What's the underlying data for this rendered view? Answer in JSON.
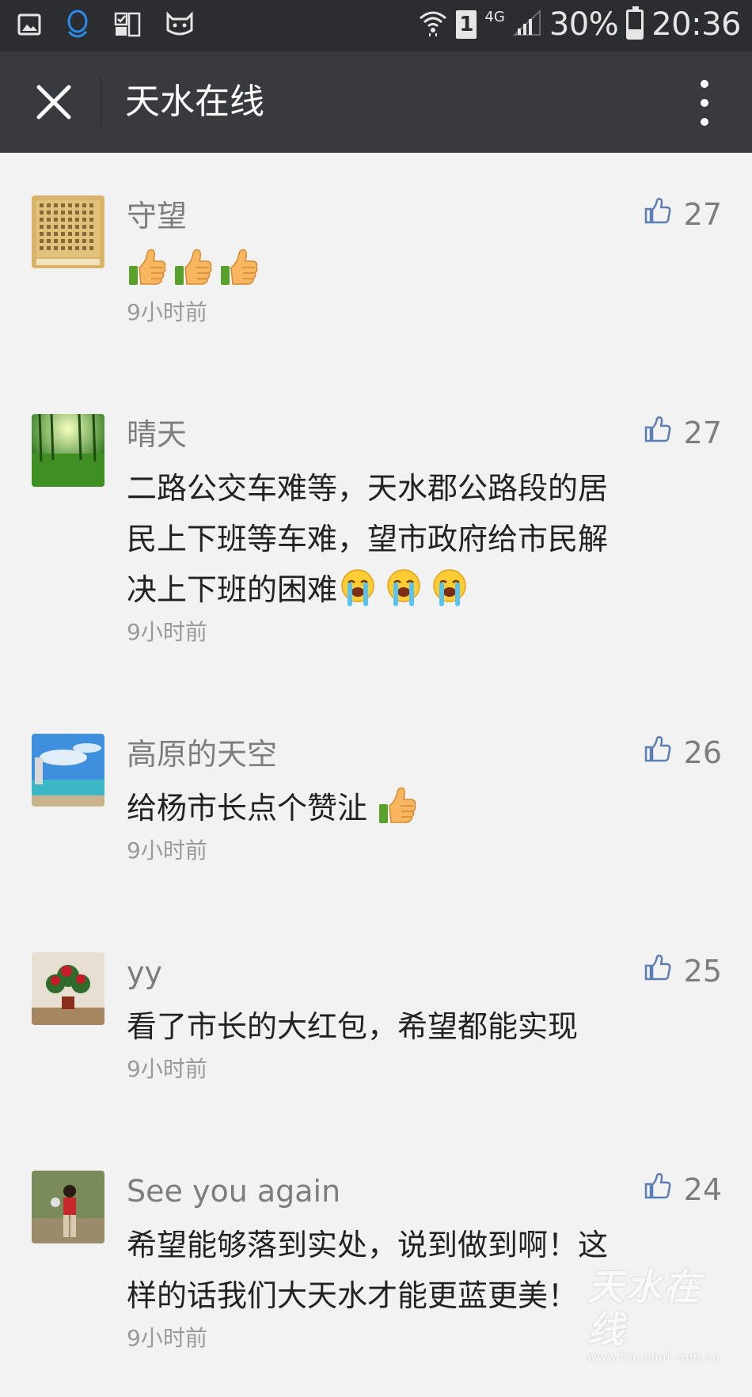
{
  "status_bar": {
    "battery_percent": "30%",
    "time": "20:36",
    "network": "4G",
    "sim": "1",
    "battery_level": 0.3
  },
  "title_bar": {
    "title": "天水在线"
  },
  "comments": [
    {
      "nickname": "守望",
      "text": "",
      "emojis": [
        "thumbs-up",
        "thumbs-up",
        "thumbs-up"
      ],
      "time": "9小时前",
      "likes": "27"
    },
    {
      "nickname": "晴天",
      "text": "二路公交车难等，天水郡公路段的居民上下班等车难，望市政府给市民解决上下班的困难",
      "emojis": [
        "crying-face",
        "crying-face",
        "crying-face"
      ],
      "time": "9小时前",
      "likes": "27"
    },
    {
      "nickname": "高原的天空",
      "text": "给杨市长点个赞沚 ",
      "emojis": [
        "thumbs-up"
      ],
      "time": "9小时前",
      "likes": "26"
    },
    {
      "nickname": "yy",
      "text": "看了市长的大红包，希望都能实现",
      "emojis": [],
      "time": "9小时前",
      "likes": "25"
    },
    {
      "nickname": "See  you  again",
      "text": "希望能够落到实处，说到做到啊！这样的话我们大天水才能更蓝更美！",
      "emojis": [],
      "time": "9小时前",
      "likes": "24"
    }
  ],
  "watermark": {
    "logo_text": "天水在线",
    "url": "www.tianshui.com.cn"
  },
  "colors": {
    "title_bar_bg": "#393a3f",
    "status_bar_bg": "#2b2d30",
    "page_bg": "#f2f2f2",
    "like_icon": "#5b7fb5"
  }
}
